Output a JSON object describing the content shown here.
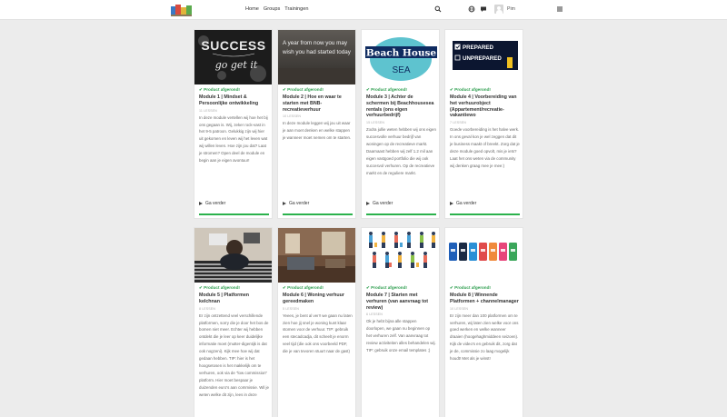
{
  "nav": {
    "items": [
      "Home",
      "Groups",
      "Trainingen"
    ]
  },
  "user": {
    "name": "Pim"
  },
  "icons": {
    "search": "search-icon",
    "globe": "globe-icon",
    "chat": "chat-icon",
    "bell": "bell-icon",
    "menu": "menu-icon"
  },
  "colors": {
    "badge": "#2e9e4f",
    "progress": "#2bb24c",
    "background": "#ececec"
  },
  "cards": [
    {
      "badge": "✔ Product afgerond!",
      "title": "Module 1 | Mindset & Persoonlijke ontwikkeling",
      "meta": "11 LESSEN",
      "desc": "In deze module vertellen wij hoe het bij ons gegaan is. Wij, zeker rock-vast in het 9-5 patroon. Gelukkig zijn wij hier uit gekomen en leven wij het leven wat wij willen leven. Hoe zijn jou dat? Laat je stromen? Open deel de module en begin aan je eigen avontuur!",
      "cta": "Ga verder",
      "image_text": ""
    },
    {
      "badge": "✔ Product afgerond!",
      "title": "Module 2 | Hoe en waar te starten met BNB-recreatieverhuur",
      "meta": "10 LESSEN",
      "desc": "In deze module leggen wij jou uit waar je aan moet denken en welke stappen je wanneer moet nemen om te starten.",
      "cta": "Ga verder",
      "image_text": "A year from now you may wish you had started today"
    },
    {
      "badge": "✔ Product afgerond!",
      "title": "Module 3 | Achter de schermen bij Beachhousesea rentals (ons eigen verhuurbedrijf)",
      "meta": "15 LESSEN",
      "desc": "Zodra jullie weten hebben wij ons eigen succesvolle verhuur bedrijf van woningen op de recreatieve markt. Daarnaast hebben wij zelf 1.2 mil aan eigen vastgoed portfolio die wij ook succesvol verhuren. Op de recreatieve markt en de reguliere markt.",
      "cta": "Ga verder",
      "image_text": "Beach House SEA"
    },
    {
      "badge": "✔ Product afgerond!",
      "title": "Module 4 | Voorbereiding van het verhuurobject (Appartement/recreatie-vakantiewo",
      "meta": "7 LESSEN",
      "desc": "Goede voorbereiding is het halve werk. In ons geval kon je wel zeggen dat dit je business maakt of breekt. Zorg dat je deze module goed opvolt, mis je iets? Laat het ons weten via de community wij denken graag mee je mee:)",
      "cta": "Ga verder",
      "image_lines": [
        "PREPARED",
        "UNPREPARED"
      ]
    },
    {
      "badge": "✔ Product afgerond!",
      "title": "Module 5 | Platformen kelchnan",
      "meta": "8 LESSEN",
      "desc": "Er zijn ontzettend veel verschillende platformen, sorry die je door het bos de bomen niet meer. Echter wij hebben ontdekt die je leer op keer duidelijke informatie moet (mutter-digentijk is dat ook nogzeni). Kijk mee hoe wij dat gedaan hebben. TIP: hier is het hoogsetosen is het makkelijk om te verhuren, ook via de \"low commission\" platform. Hier moet bespaar je duizenden euro's aan commissie. Wil je weten welke dit zijn, lees in deze",
      "cta": "Ga verder"
    },
    {
      "badge": "✔ Product afgerond!",
      "title": "Module 6 | Woning verhuur gereedmaken",
      "meta": "5 LESSEN",
      "desc": "Yeees, je bent al ver!! we gaan nu laten zien hoe jij snel je woning kunt klaar stomen voor de verhuur. TIP: gebruik een stecadcadja, dit scheelt je enorm veel tijd (die ook ons voorbeeld PDF, die je van tevoren stuurt naar de gast)",
      "cta": "Ga verder"
    },
    {
      "badge": "✔ Product afgerond!",
      "title": "Module 7 | Starten met verhuren (van aanvraag tot review)",
      "meta": "6 LESSEN",
      "desc": "Ok je hebt bijna alle stappen doorlopen, we gaan nu beginnen op het verhuren zelf. Van aanvraag tot review activiteiten alles behandelen wij. TIP: gebruik onze email templates ;)",
      "cta": "Ga verder"
    },
    {
      "badge": "✔ Product afgerond!",
      "title": "Module 8 | Winnende Platformen + channelmanager",
      "meta": "10 LESSEN",
      "desc": "Er zijn meer dan 100 platformen om te verhuren, wij laten zien welke voor ons goed werken en welke wanneer draaien (hoogehaghmiddeen seizoen). Kijk de video's en gebruik dit, zorg dat je de, commissie zo laag mogelijk houdt! Met als je winst!",
      "cta": "Ga verder"
    }
  ]
}
